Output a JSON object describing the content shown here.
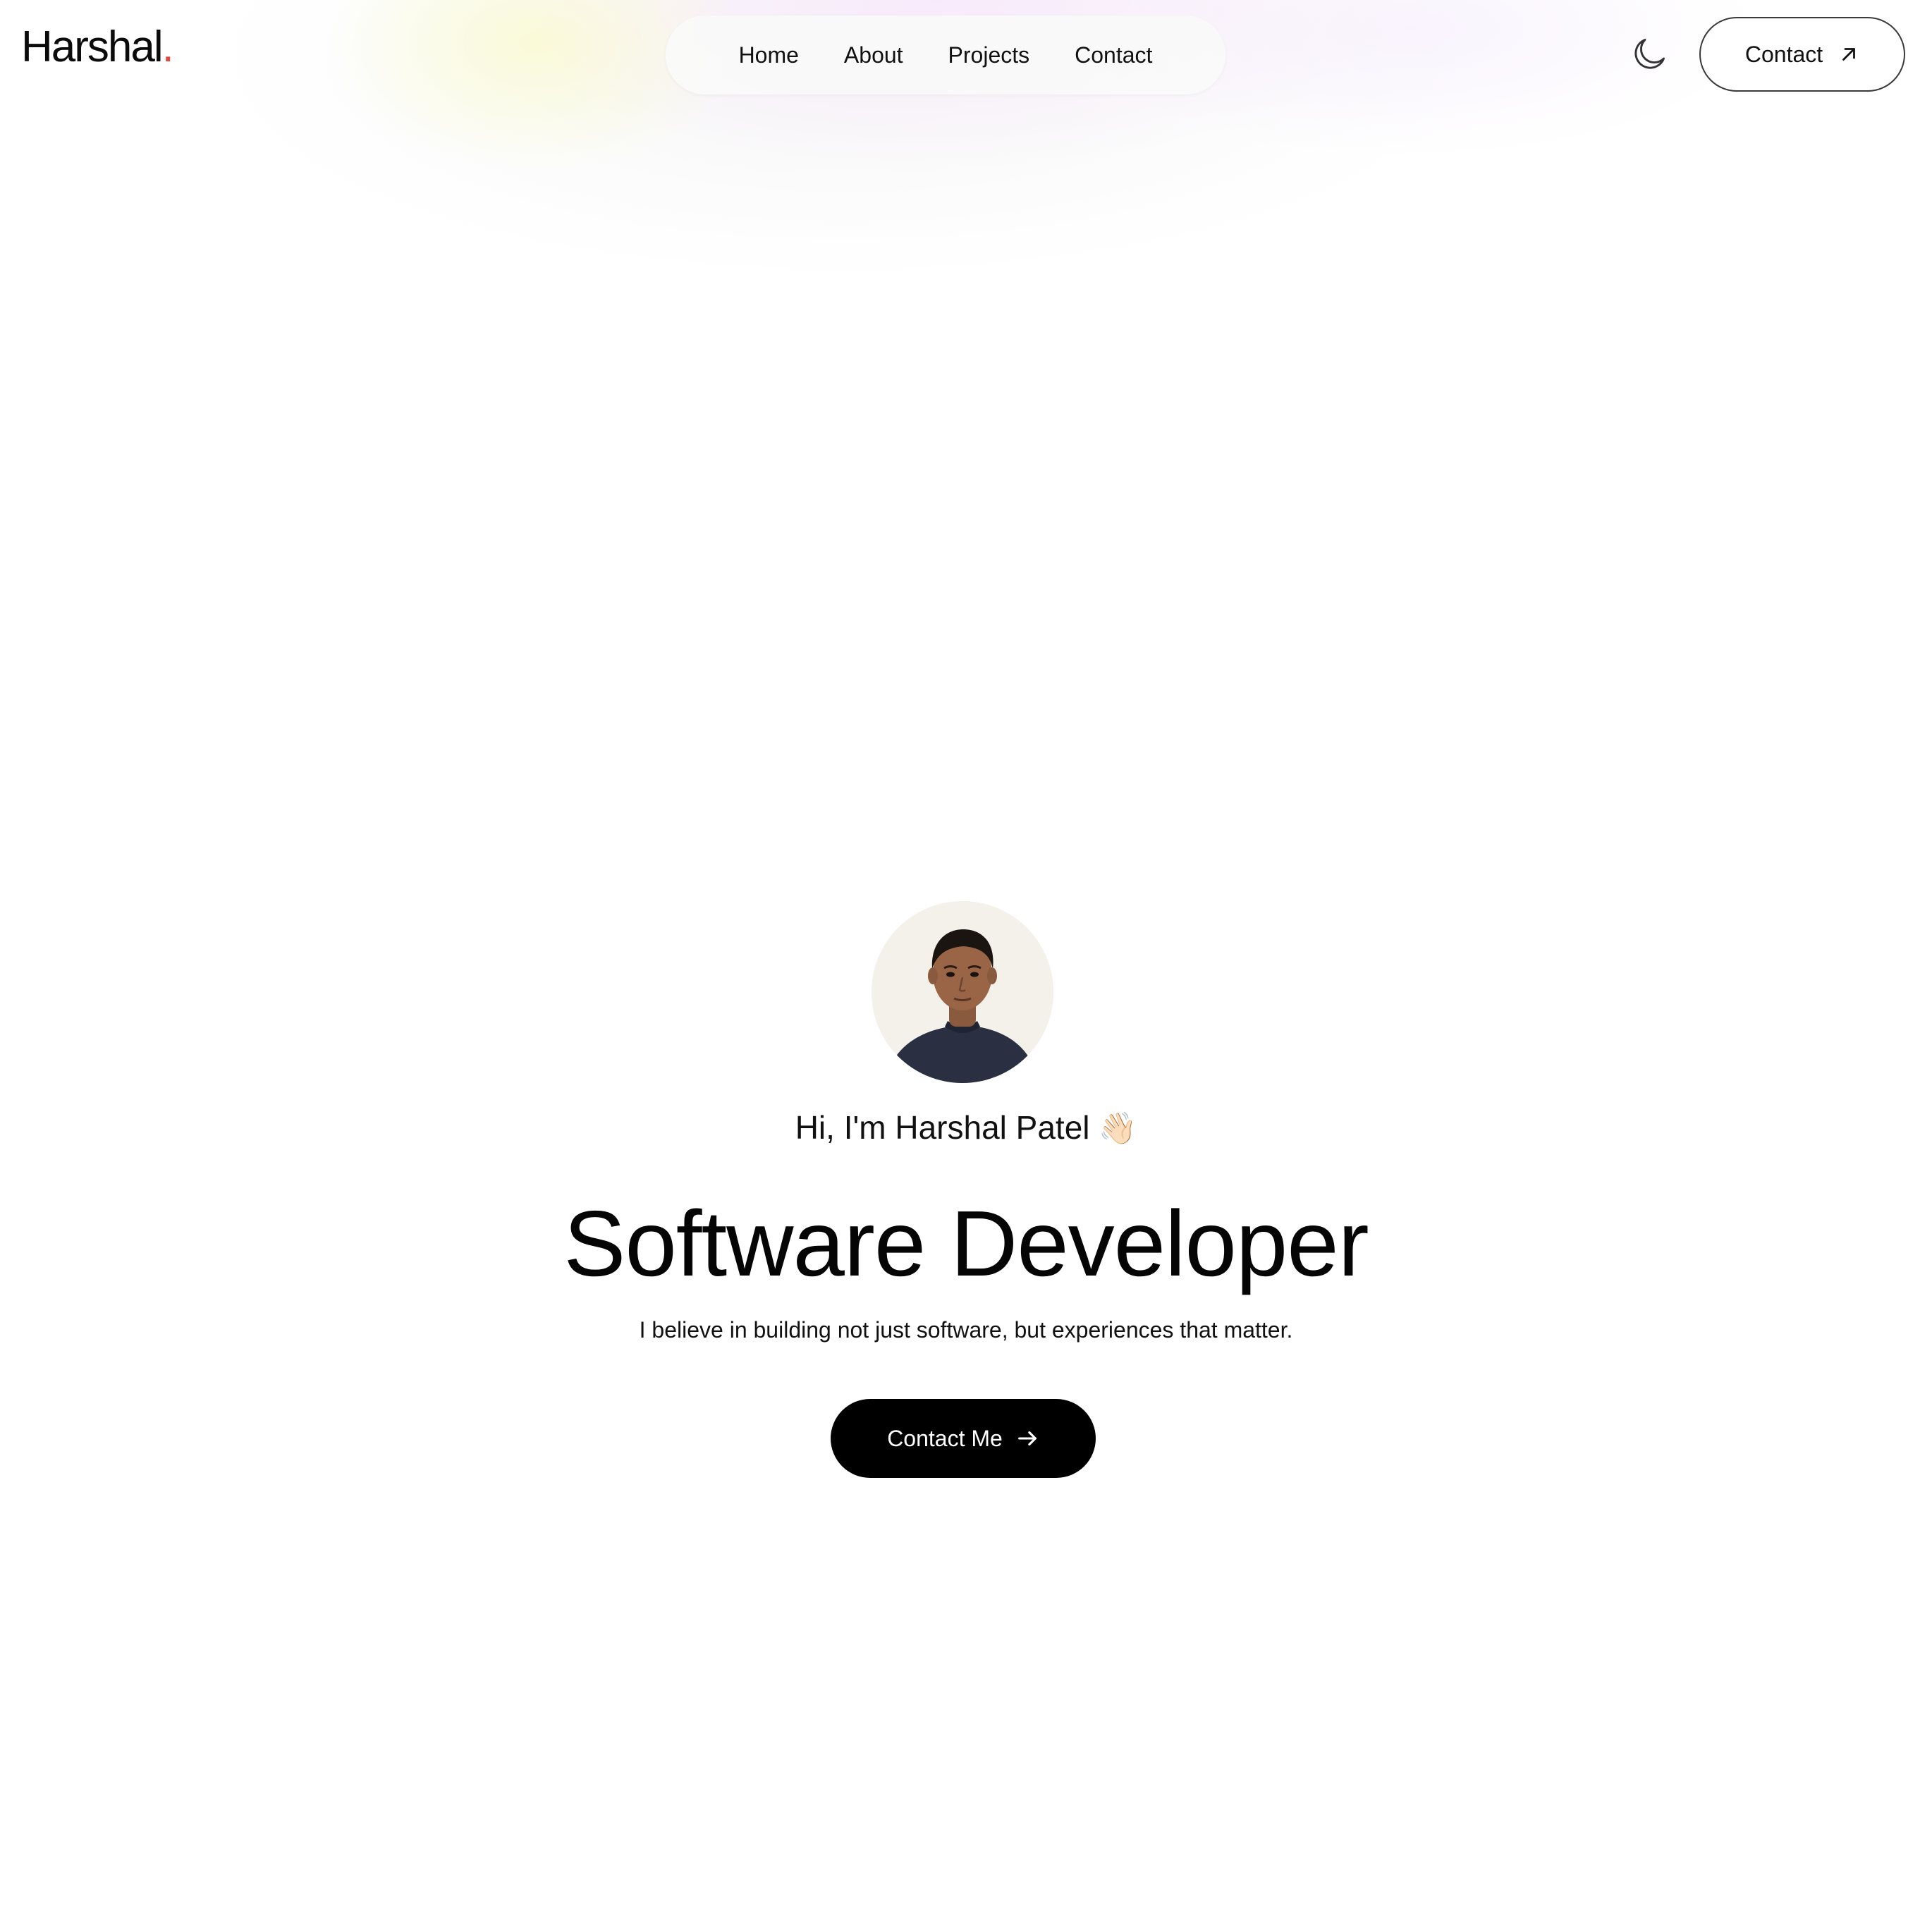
{
  "brand": {
    "name": "Harshal",
    "dot": ".",
    "dot_color": "#e5483f"
  },
  "nav": {
    "items": [
      {
        "label": "Home"
      },
      {
        "label": "About"
      },
      {
        "label": "Projects"
      },
      {
        "label": "Contact"
      }
    ]
  },
  "header": {
    "theme_toggle_icon": "moon-icon",
    "contact_label": "Contact",
    "contact_icon": "arrow-up-right-icon"
  },
  "hero": {
    "greeting": "Hi, I'm Harshal Patel",
    "greeting_emoji": "👋🏻",
    "title": "Software Developer",
    "tagline": "I believe in building not just software, but experiences that matter.",
    "cta_label": "Contact Me",
    "cta_icon": "arrow-right-icon"
  },
  "colors": {
    "background": "#ffffff",
    "text": "#0b0b0b",
    "cta_background": "#000000",
    "cta_text": "#ffffff"
  }
}
